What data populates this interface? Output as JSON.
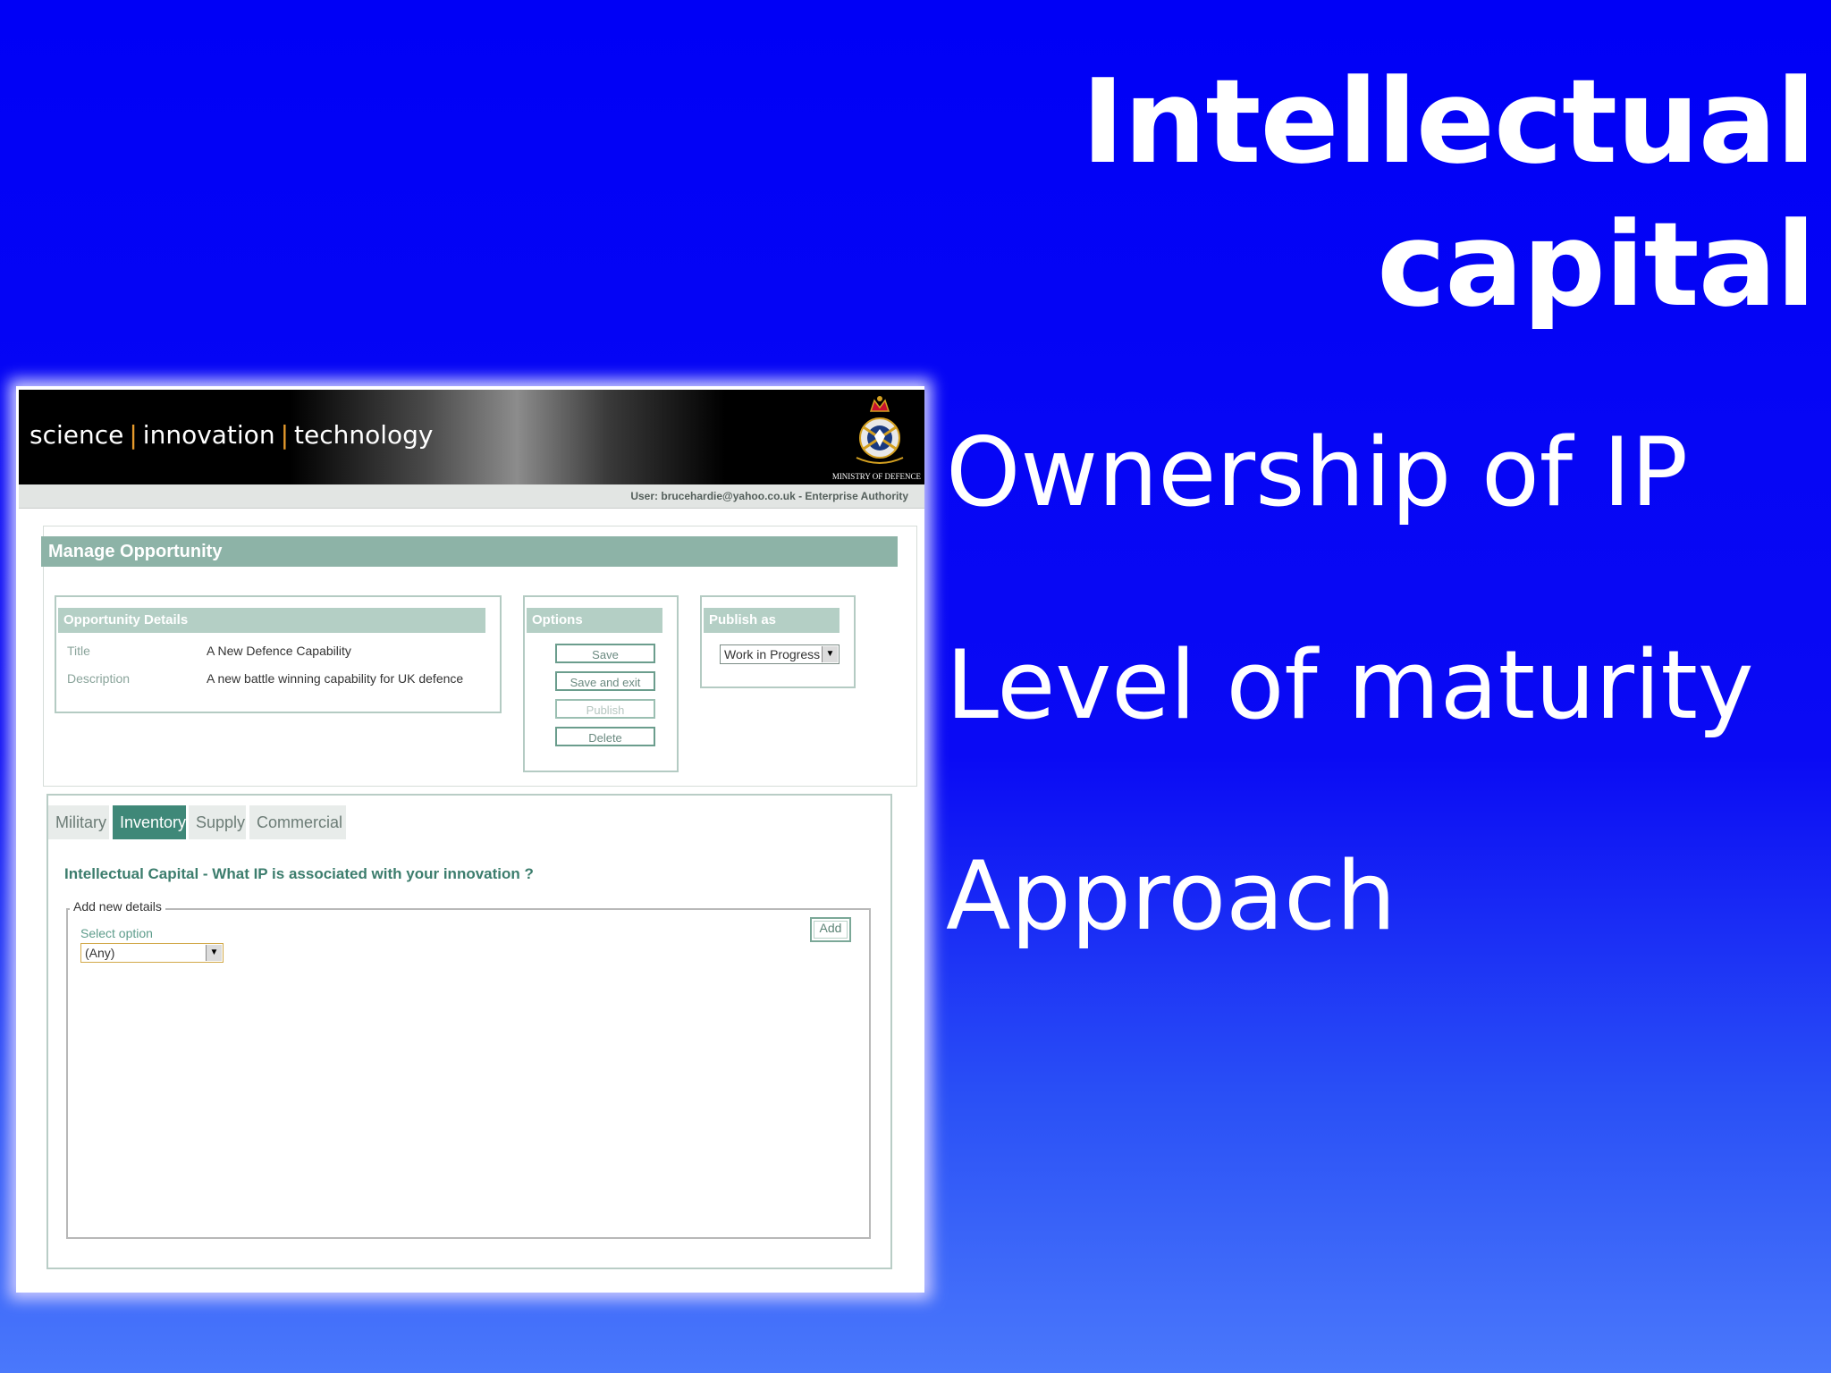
{
  "slide": {
    "title": "Intellectual capital",
    "bullets": [
      "Ownership of IP",
      "Level of maturity",
      "Approach"
    ]
  },
  "app": {
    "brand": {
      "part1": "science",
      "part2": "innovation",
      "part3": "technology"
    },
    "crest_caption": "MINISTRY OF DEFENCE",
    "user_line": "User:  brucehardie@yahoo.co.uk - Enterprise Authority",
    "page_title": "Manage Opportunity",
    "opportunity": {
      "heading": "Opportunity Details",
      "title_label": "Title",
      "title_value": "A New Defence Capability",
      "description_label": "Description",
      "description_value": "A new battle winning capability for UK defence"
    },
    "options": {
      "heading": "Options",
      "save": "Save",
      "save_exit": "Save and exit",
      "publish": "Publish",
      "delete": "Delete"
    },
    "publish_as": {
      "heading": "Publish as",
      "selected": "Work in Progress"
    },
    "tabs": [
      "Military",
      "Inventory",
      "Supply",
      "Commercial"
    ],
    "active_tab": "Inventory",
    "ic_question": "Intellectual Capital - What IP is associated with your innovation ?",
    "add_new": {
      "legend": "Add new details",
      "select_label": "Select option",
      "selected": "(Any)",
      "add_button": "Add"
    }
  },
  "colors": {
    "slide_bg": "#0000f6",
    "accent_green": "#3f8878",
    "header_green": "#8db3a7",
    "separator_orange": "#e69a2c"
  }
}
